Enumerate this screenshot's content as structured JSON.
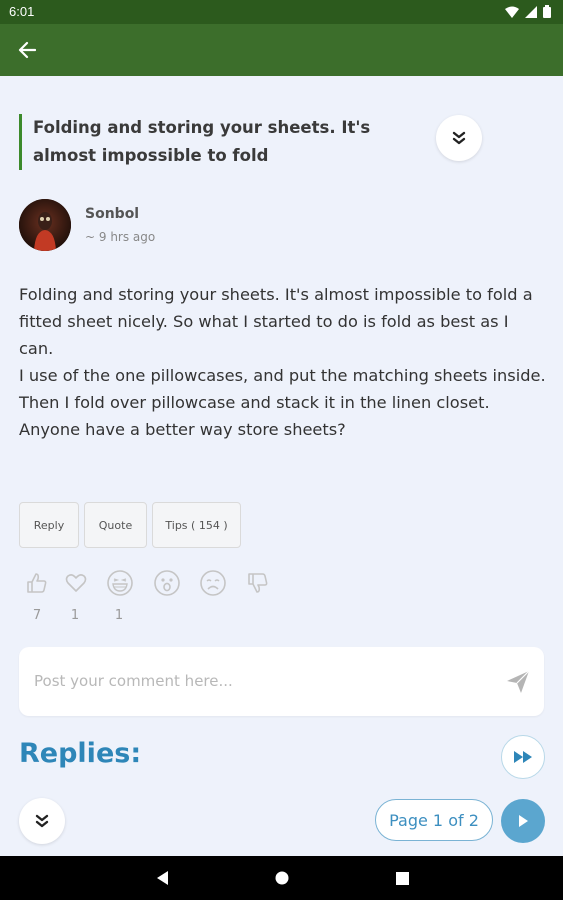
{
  "status_bar": {
    "time": "6:01"
  },
  "post": {
    "title": "Folding and storing your sheets. It's almost impossible to fold",
    "author": "Sonbol",
    "time_ago": "~ 9 hrs ago",
    "body_lines": [
      "Folding and storing your sheets. It's almost impossible to fold a fitted sheet nicely. So what I started to do is fold as best as I can.",
      "I use of the one pillowcases, and put the matching sheets inside. Then I fold over pillowcase and stack it in the linen closet. Anyone have a better way store sheets?"
    ]
  },
  "actions": {
    "reply": "Reply",
    "quote": "Quote",
    "tips": "Tips ( 154 )"
  },
  "reactions": [
    {
      "icon": "thumbs-up-icon",
      "count": "7"
    },
    {
      "icon": "heart-icon",
      "count": "1"
    },
    {
      "icon": "grin-icon",
      "count": "1"
    },
    {
      "icon": "surprised-icon",
      "count": ""
    },
    {
      "icon": "sad-icon",
      "count": ""
    },
    {
      "icon": "thumbs-down-icon",
      "count": ""
    }
  ],
  "comment": {
    "placeholder": "Post your comment here..."
  },
  "replies": {
    "heading": "Replies:",
    "page_label": "Page 1 of 2"
  },
  "colors": {
    "app_bar": "#3c6e2b",
    "status_bar": "#2c5a1d",
    "accent_blue": "#2e86b8",
    "background": "#eef2fb"
  }
}
